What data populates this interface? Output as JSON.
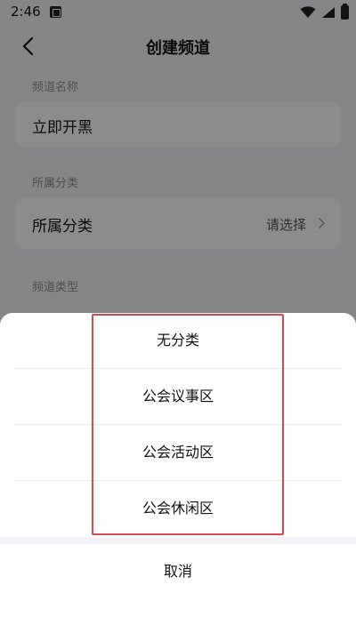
{
  "status_bar": {
    "time": "2:46"
  },
  "nav": {
    "title": "创建频道"
  },
  "form": {
    "channel_name_label": "频道名称",
    "channel_name_value": "立即开黑",
    "category_label": "所属分类",
    "category_row_label": "所属分类",
    "category_row_value": "请选择",
    "channel_type_label": "频道类型"
  },
  "sheet": {
    "options": [
      "无分类",
      "公会议事区",
      "公会活动区",
      "公会休闲区"
    ],
    "cancel_label": "取消"
  },
  "colors": {
    "highlight": "#e0454f",
    "overlay": "rgba(0,0,0,0.45)"
  }
}
